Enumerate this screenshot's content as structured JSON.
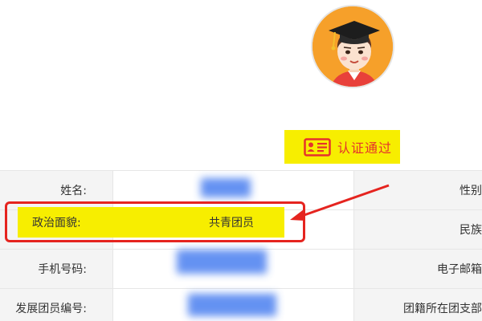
{
  "avatar": {
    "icon": "graduate-avatar-icon"
  },
  "badge": {
    "label": "认证通过",
    "icon": "id-card-icon",
    "bg": "#f7ee00",
    "color": "#e5322c"
  },
  "rows": [
    {
      "label": "姓名:",
      "value": "",
      "right_label": "性别"
    },
    {
      "label": "政治面貌:",
      "value": "共青团员",
      "right_label": "民族"
    },
    {
      "label": "手机号码:",
      "value": "",
      "right_label": "电子邮箱"
    },
    {
      "label": "发展团员编号:",
      "value": "",
      "right_label": "团籍所在团支部"
    }
  ],
  "annotation": {
    "color": "#e5241f",
    "highlight": "#f7ee00"
  }
}
